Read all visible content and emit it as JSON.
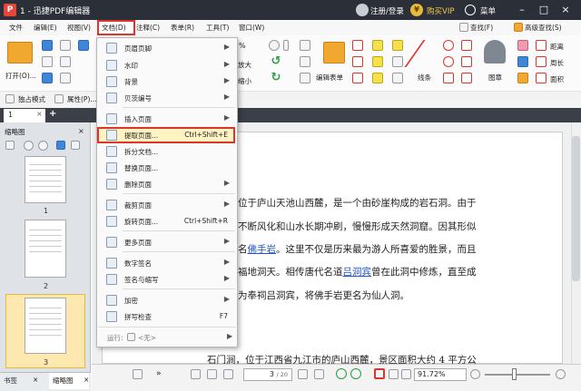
{
  "titlebar": {
    "app_title": "1 - 迅捷PDF编辑器",
    "login": "注册/登录",
    "vip": "购买VIP",
    "menu": "菜单",
    "minimize": "–",
    "maximize": "□",
    "close": "×"
  },
  "menubar": {
    "items": [
      "文件",
      "编辑(E)",
      "视图(V)",
      "文档(D)",
      "注释(C)",
      "表单(R)",
      "工具(T)",
      "窗口(W)"
    ],
    "find": "查找(F)",
    "adv_find": "高级查找(S)"
  },
  "ribbon": {
    "open": "打开(O)...",
    "zoom_pct": "%",
    "enlarge": "放大",
    "reduce": "缩小",
    "edit_form": "编辑表单",
    "line": "线条",
    "stamp": "图章",
    "ranging": "距离",
    "perimeter": "周长",
    "area": "面积",
    "exclusive": "独占模式",
    "properties": "属性(P)..."
  },
  "doctabs": {
    "tab1": "1"
  },
  "thumbpanel": {
    "title": "缩略图",
    "pages": [
      "1",
      "2",
      "3"
    ],
    "tab_bookmark": "书签",
    "tab_thumbs": "缩略图"
  },
  "document": {
    "lines": [
      {
        "pre": "位于庐山天池山西麓，是一个由砂崖构成的岩石洞。由于",
        "link": "",
        "post": ""
      },
      {
        "pre": "不断风化和山水长期冲刷，慢慢形成天然洞窟。因其形似",
        "link": "",
        "post": ""
      },
      {
        "pre": "名",
        "link": "佛手岩",
        "post": "。这里不仅是历来最为游人所喜爱的胜景，而且"
      },
      {
        "pre": "福地洞天。相传唐代名道",
        "link": "吕洞宾",
        "post": "曾在此洞中修炼，直至成"
      },
      {
        "pre": "为奉祠吕洞宾，将佛手岩更名为仙人洞。",
        "link": "",
        "post": ""
      },
      {
        "pre": "石门涧，位于江西省九江市的庐山西麓，景区面积大约 4 平方公",
        "link": "",
        "post": ""
      }
    ]
  },
  "statusbar": {
    "page_current": "3",
    "page_total": "/ 20",
    "zoom": "91.72%"
  },
  "dropdown": {
    "items": [
      {
        "label": "页眉页脚",
        "arrow": "▶",
        "shortcut": ""
      },
      {
        "label": "水印",
        "arrow": "▶",
        "shortcut": ""
      },
      {
        "label": "背景",
        "arrow": "▶",
        "shortcut": ""
      },
      {
        "label": "贝茨编号",
        "arrow": "▶",
        "shortcut": ""
      },
      {
        "label": "插入页面",
        "arrow": "▶",
        "shortcut": ""
      },
      {
        "label": "提取页面...",
        "arrow": "",
        "shortcut": "Ctrl+Shift+E"
      },
      {
        "label": "拆分文档...",
        "arrow": "",
        "shortcut": ""
      },
      {
        "label": "替换页面...",
        "arrow": "",
        "shortcut": ""
      },
      {
        "label": "删除页面",
        "arrow": "▶",
        "shortcut": ""
      },
      {
        "label": "裁剪页面",
        "arrow": "▶",
        "shortcut": ""
      },
      {
        "label": "旋转页面...",
        "arrow": "",
        "shortcut": "Ctrl+Shift+R"
      },
      {
        "label": "更多页面",
        "arrow": "▶",
        "shortcut": ""
      },
      {
        "label": "数字签名",
        "arrow": "▶",
        "shortcut": ""
      },
      {
        "label": "签名与缩写",
        "arrow": "▶",
        "shortcut": ""
      },
      {
        "label": "加密",
        "arrow": "▶",
        "shortcut": ""
      },
      {
        "label": "拼写检查",
        "arrow": "",
        "shortcut": "F7"
      }
    ],
    "run_label": "运行:",
    "run_value": "<无>"
  },
  "colors": {
    "titlebar": "#2b2f37",
    "highlight_border": "#e0342a",
    "selection": "#fff3c4",
    "link": "#2255cc"
  }
}
